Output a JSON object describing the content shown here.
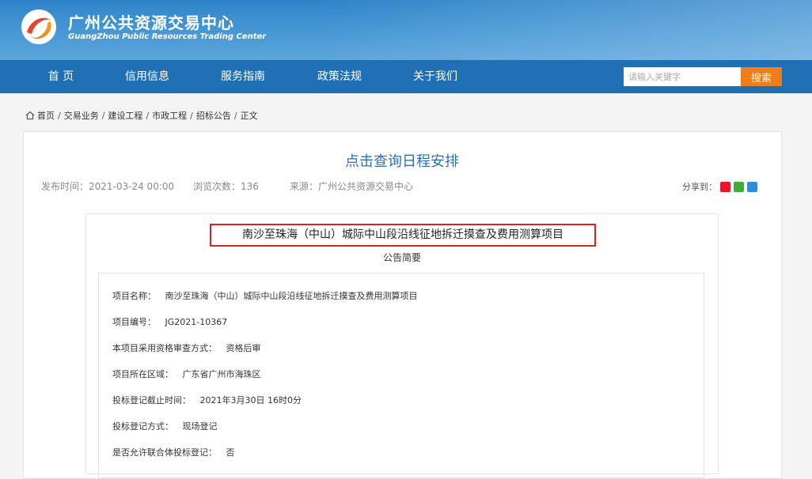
{
  "header": {
    "title": "广州公共资源交易中心",
    "subtitle": "GuangZhou Public Resources Trading Center"
  },
  "nav": {
    "items": [
      "首 页",
      "信用信息",
      "服务指南",
      "政策法规",
      "关于我们"
    ],
    "search_placeholder": "请输入关键字",
    "search_label": "搜索"
  },
  "breadcrumb": [
    "首页",
    "交易业务",
    "建设工程",
    "市政工程",
    "招标公告",
    "正文"
  ],
  "article": {
    "title": "点击查询日程安排",
    "publish_time": "发布时间：2021-03-24 00:00",
    "views": "浏览次数：136",
    "source": "来源：广州公共资源交易中心",
    "share_label": "分享到："
  },
  "announcement": {
    "project_title": "南沙至珠海（中山）城际中山段沿线征地拆迁摸查及费用测算项目",
    "summary_label": "公告简要",
    "rows": [
      {
        "label": "项目名称：",
        "value": "南沙至珠海（中山）城际中山段沿线征地拆迁摸查及费用测算项目"
      },
      {
        "label": "项目编号：",
        "value": "JG2021-10367"
      },
      {
        "label": "本项目采用资格审查方式：",
        "value": "资格后审"
      },
      {
        "label": "项目所在区域：",
        "value": "广东省广州市海珠区"
      },
      {
        "label": "投标登记截止时间：",
        "value": "2021年3月30日 16时0分"
      },
      {
        "label": "投标登记方式：",
        "value": "现场登记"
      },
      {
        "label": "是否允许联合体投标登记：",
        "value": "否"
      }
    ]
  },
  "colors": {
    "header_blue": "#3a8fd0",
    "nav_blue": "#1f6fb5",
    "search_orange": "#ef7d1a",
    "title_blue": "#2b6fb5",
    "highlight_red": "#e02020"
  }
}
